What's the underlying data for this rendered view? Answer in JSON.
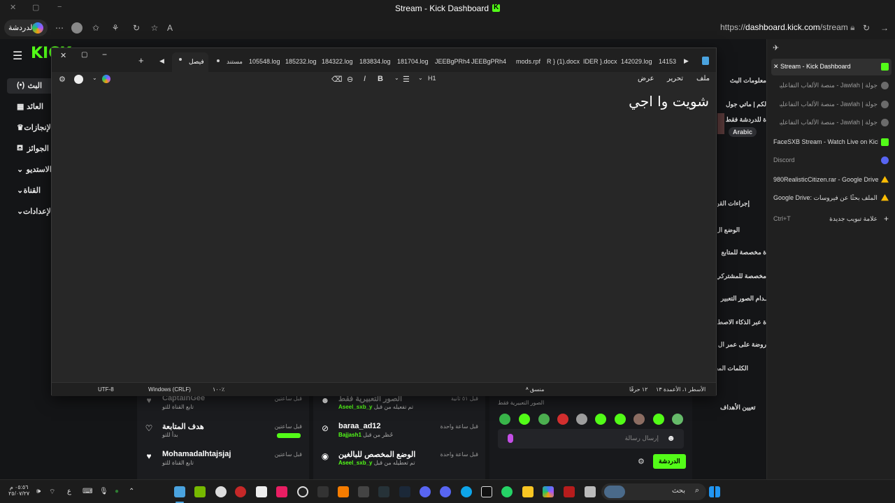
{
  "window": {
    "title": "Stream - Kick Dashboard"
  },
  "browser": {
    "profile_label": "الدردشة",
    "url_prefix": "https://",
    "url_domain": "dashboard.kick.com",
    "url_path": "/stream"
  },
  "side_panel": {
    "tabs": [
      {
        "label": "Stream - Kick Dashboard",
        "active": true,
        "fav_color": "#53fc18"
      },
      {
        "label": "جولة | Jawlah - منصة الألعاب التفاعلية",
        "fav_color": "#6b6b6b"
      },
      {
        "label": "جولة | Jawlah - منصة الألعاب التفاعلية",
        "fav_color": "#6b6b6b"
      },
      {
        "label": "جولة | Jawlah - منصة الألعاب التفاعلية",
        "fav_color": "#6b6b6b"
      },
      {
        "label": "FaceSXB Stream - Watch Live on Kick",
        "fav_color": "#53fc18"
      },
      {
        "label": "Discord",
        "fav_color": "#5865f2"
      },
      {
        "label": "980RealisticCitizen.rar - Google Drive",
        "fav_color": "#fbbc04"
      },
      {
        "label": "Google Drive: الملف بحثًا عن فيروسات",
        "fav_color": "#fbbc04"
      }
    ],
    "new_tab_label": "علامة تبويب جديدة",
    "new_tab_shortcut": "Ctrl+T"
  },
  "kick_nav": [
    {
      "label": "البث",
      "icon": "(•)"
    },
    {
      "label": "العائد",
      "icon": "▦"
    },
    {
      "label": "الإنجازات",
      "icon": "♛"
    },
    {
      "label": "الجوائز",
      "icon": "⛾"
    },
    {
      "label": "الاستديو",
      "icon": "⌄"
    },
    {
      "label": "القناة",
      "icon": "⌄"
    },
    {
      "label": "الإعدادات",
      "icon": "⌄"
    }
  ],
  "kick_side_labels": [
    "معلومات البث",
    "لكم | ماتي جول",
    "ة للدردشة فقط",
    "إجراءات القن",
    "الوضع ال",
    "ة مخصصة للمتابع",
    "مخصصة للمشتركي",
    "ـدام الصور التعبير",
    "ة عبر الذكاء الاصط",
    "روضة على عمر ال",
    "الكلمات المحـ",
    "تعيين الأهداف"
  ],
  "language_chip": "Arabic",
  "feed_left": [
    {
      "user": "CaptainGee",
      "sub": "تابع القناة للتو",
      "time": "قبل ساعتين",
      "icon": "♥"
    },
    {
      "user": "هدف المتابعة",
      "sub": "بدأ للتو",
      "time": "قبل ساعتين",
      "icon": "♡"
    },
    {
      "user": "Mohamadalhtajsjaj",
      "sub": "تابع القناة للتو",
      "time": "قبل ساعتين",
      "icon": "♥"
    }
  ],
  "feed_mid": [
    {
      "user": "الصور التعبيرية فقط",
      "sub_pre": "تم تفعيله من قبل",
      "sub_user": "Aseel_sxb_y",
      "time": "قبل ٥١ ثانية",
      "icon": "☻"
    },
    {
      "user": "baraa_ad12",
      "sub_pre": "حُظر من قبل",
      "sub_user": "Bajjash1",
      "time": "قبل ساعة واحدة",
      "icon": "⊘"
    },
    {
      "user": "الوضع المخصص للبالغين",
      "sub_pre": "تم تعطيله من قبل",
      "sub_user": "Aseel_sxb_y",
      "time": "قبل ساعة واحدة",
      "icon": "◉"
    }
  ],
  "chat": {
    "emote_only_label": "الصور التعبيرية فقط",
    "placeholder": "إرسال رسالة",
    "send_label": "الدردشة"
  },
  "notepad": {
    "tabs": [
      "فيصل",
      "مستند",
      "105548.log",
      "185232.log",
      "184322.log",
      "183834.log",
      "181704.log",
      "JEEBgPRh4",
      "JEEBgPRh4",
      "mods.rpf",
      "R } (1).docx",
      "IDER }.docx",
      "142029.log",
      "14153"
    ],
    "menu": [
      "ملف",
      "تحرير",
      "عرض"
    ],
    "heading_label": "H1",
    "content": "شويت وا اجي",
    "status": {
      "position": "الأسطر ١، الأعمدة ١٣",
      "chars": "١٢ حرفًا",
      "format": "منسق",
      "zoom": "١٠٠٪",
      "line_ending": "Windows (CRLF)",
      "encoding": "UTF-8"
    }
  },
  "taskbar": {
    "search_label": "بحث",
    "time": "٠٥:٥٦ م",
    "date": "٢٥/٠٧/٢٧",
    "lang": "ع"
  },
  "colors": {
    "kick_green": "#53fc18",
    "bg": "#141517"
  }
}
